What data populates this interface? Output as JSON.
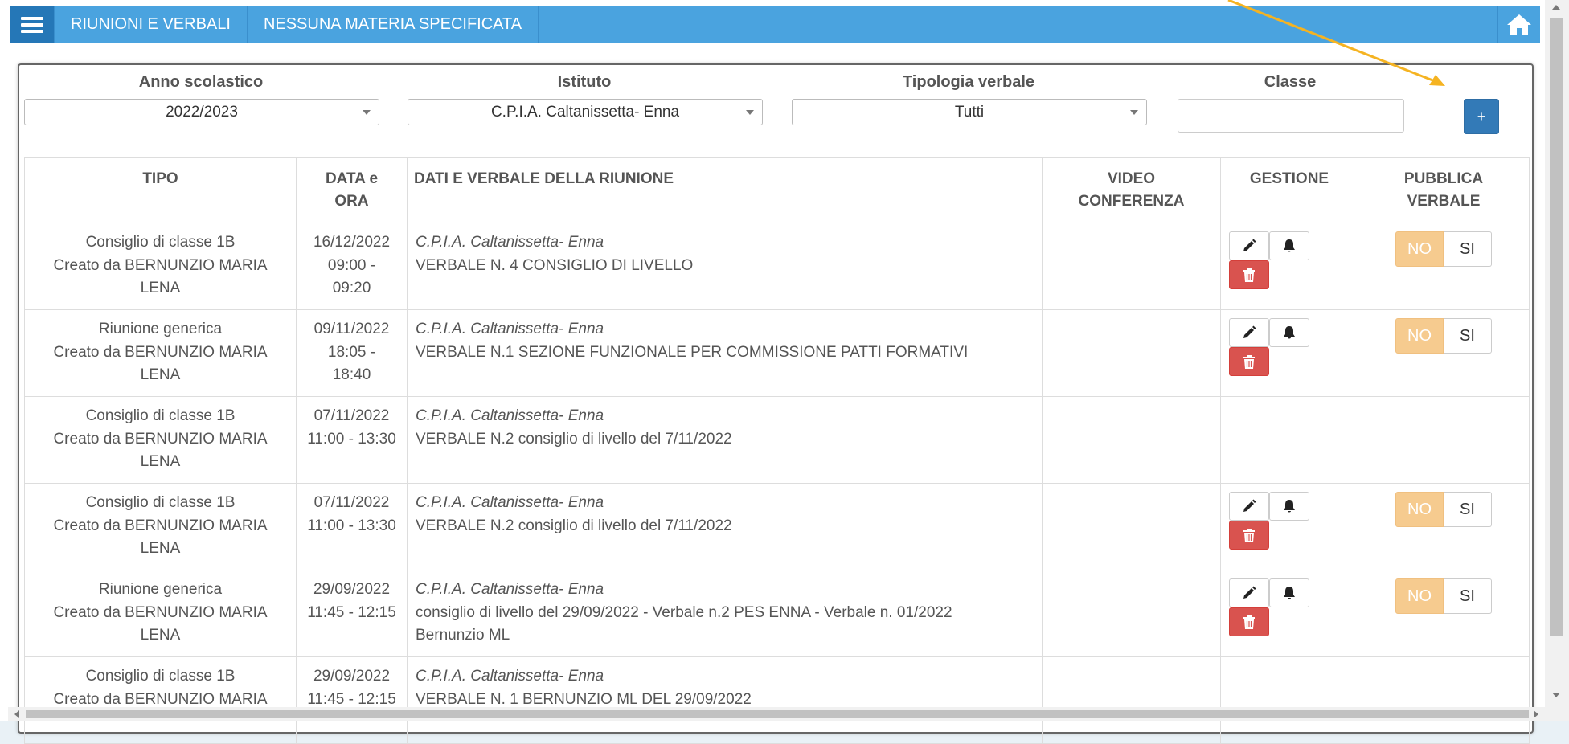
{
  "topbar": {
    "items": [
      "RIUNIONI E VERBALI",
      "NESSUNA MATERIA SPECIFICATA"
    ],
    "accent_color": "#4aa3df",
    "menu_icon": "hamburger-menu-icon",
    "home_icon": "home-icon"
  },
  "filters": {
    "anno_label": "Anno scolastico",
    "anno_value": "2022/2023",
    "istituto_label": "Istituto",
    "istituto_value": "C.P.I.A. Caltanissetta- Enna",
    "tipologia_label": "Tipologia verbale",
    "tipologia_value": "Tutti",
    "classe_label": "Classe",
    "classe_value": "",
    "add_label": "+"
  },
  "table": {
    "headers": {
      "tipo": "TIPO",
      "data_1": "DATA e",
      "data_2": "ORA",
      "dati": "DATI E VERBALE DELLA RIUNIONE",
      "video_1": "VIDEO",
      "video_2": "CONFERENZA",
      "gestione": "GESTIONE",
      "pubblica_1": "PUBBLICA",
      "pubblica_2": "VERBALE"
    },
    "rows": [
      {
        "tipo": "Consiglio di classe 1B",
        "creato": "Creato da BERNUNZIO MARIA",
        "creato2": "LENA",
        "date": "16/12/2022",
        "time1": "09:00 -",
        "time2": "09:20",
        "istituto": "C.P.I.A. Caltanissetta- Enna",
        "verbale": "VERBALE N. 4 CONSIGLIO DI LIVELLO",
        "verbale2": "",
        "no": "NO",
        "si": "SI"
      },
      {
        "tipo": "Riunione generica",
        "creato": "Creato da BERNUNZIO MARIA",
        "creato2": "LENA",
        "date": "09/11/2022",
        "time1": "18:05 -",
        "time2": "18:40",
        "istituto": "C.P.I.A. Caltanissetta- Enna",
        "verbale": "VERBALE N.1 SEZIONE FUNZIONALE PER COMMISSIONE PATTI FORMATIVI",
        "verbale2": "",
        "no": "NO",
        "si": "SI"
      },
      {
        "tipo": "Consiglio di classe 1B",
        "creato": "Creato da BERNUNZIO MARIA",
        "creato2": "LENA",
        "date": "07/11/2022",
        "time1": "11:00 - 13:30",
        "time2": "",
        "istituto": "C.P.I.A. Caltanissetta- Enna",
        "verbale": "VERBALE N.2 consiglio di livello del 7/11/2022",
        "verbale2": ""
      },
      {
        "tipo": "Consiglio di classe 1B",
        "creato": "Creato da BERNUNZIO MARIA",
        "creato2": "LENA",
        "date": "07/11/2022",
        "time1": "11:00 - 13:30",
        "time2": "",
        "istituto": "C.P.I.A. Caltanissetta- Enna",
        "verbale": "VERBALE N.2 consiglio di livello del 7/11/2022",
        "verbale2": "",
        "no": "NO",
        "si": "SI"
      },
      {
        "tipo": "Riunione generica",
        "creato": "Creato da BERNUNZIO MARIA",
        "creato2": "LENA",
        "date": "29/09/2022",
        "time1": "11:45 - 12:15",
        "time2": "",
        "istituto": "C.P.I.A. Caltanissetta- Enna",
        "verbale": "consiglio di livello del 29/09/2022 - Verbale n.2 PES ENNA - Verbale n. 01/2022",
        "verbale2": "Bernunzio ML",
        "no": "NO",
        "si": "SI"
      },
      {
        "tipo": "Consiglio di classe 1B",
        "creato": "Creato da BERNUNZIO MARIA",
        "creato2": "",
        "date": "29/09/2022",
        "time1": "11:45 - 12:15",
        "time2": "",
        "istituto": "C.P.I.A. Caltanissetta- Enna",
        "verbale": "VERBALE N. 1 BERNUNZIO ML DEL 29/09/2022",
        "verbale2": ""
      }
    ],
    "icons": {
      "edit": "pencil-icon",
      "notify": "bell-icon",
      "delete": "trash-icon"
    },
    "colors": {
      "delete_button": "#d9534f",
      "no_toggle": "#f6cb8f",
      "add_button": "#337ab7"
    }
  }
}
